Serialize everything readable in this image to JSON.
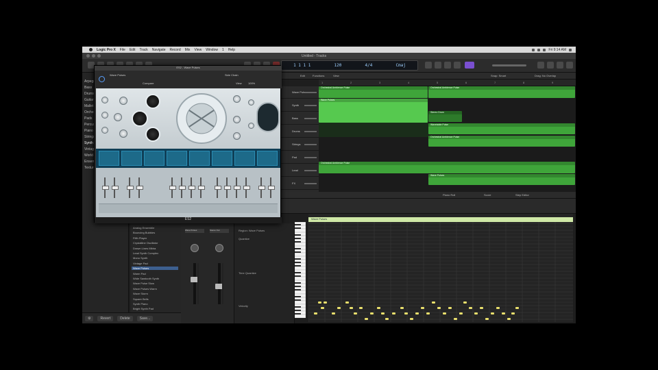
{
  "menubar": {
    "app_name": "Logic Pro X",
    "items": [
      "File",
      "Edit",
      "Track",
      "Navigate",
      "Record",
      "Mix",
      "View",
      "Window",
      "1",
      "Help"
    ],
    "clock": "Fri 9:14 AM"
  },
  "window": {
    "title": "Untitled - Tracks"
  },
  "lcd": {
    "position": "1 1 1 1",
    "tempo": "120",
    "signature": "4/4",
    "key": "Cmaj"
  },
  "library": {
    "categories": [
      "Arpeggiator",
      "Bass",
      "Drums",
      "Guitar",
      "Mallet",
      "Orchestral",
      "Pads",
      "Percussion",
      "Piano",
      "Strings",
      "Synth",
      "Vintage",
      "World",
      "Ensembles",
      "Textures"
    ],
    "selected_category": "Synth"
  },
  "presets": {
    "items": [
      "Analog Ensemble",
      "Bouncing Bubbles",
      "Fifth Player",
      "Crystalline Oscillator",
      "Drawn Lines Mbira",
      "Lead Synth Complex",
      "Mono Synth",
      "Vintage Pad",
      "Wave Pulses",
      "Warm Pad",
      "Wide Sawtooth Synth",
      "Wave Pulse Slow",
      "Wave Pulses Warm",
      "Wave Storm",
      "Square Bells",
      "Synth Piano",
      "Bright Synth Pad"
    ],
    "selected": "Wave Pulses"
  },
  "library_footer": {
    "revert": "Revert",
    "delete": "Delete",
    "save": "Save..."
  },
  "mixer": {
    "strips": [
      {
        "name": "Wave Pulses"
      },
      {
        "name": "Stereo Out"
      }
    ]
  },
  "editor_panel": {
    "region_label": "Region: Wave Pulses",
    "quantize_label": "Quantize",
    "time_quantize_label": "Time Quantize",
    "velocity_label": "Velocity"
  },
  "tracks_toolbar": {
    "edit": "Edit",
    "functions": "Functions",
    "view": "View",
    "snap": "Snap: Smart",
    "drag": "Drag: No Overlap"
  },
  "ruler": {
    "ticks": [
      "1",
      "2",
      "3",
      "4",
      "5",
      "6",
      "7",
      "8",
      "9"
    ]
  },
  "tracks": [
    {
      "name": "Wave Pulses"
    },
    {
      "name": "Synth"
    },
    {
      "name": "Bass"
    },
    {
      "name": "Drums"
    },
    {
      "name": "Strings"
    },
    {
      "name": "Pad"
    },
    {
      "name": "Lead"
    },
    {
      "name": "FX"
    }
  ],
  "regions": [
    {
      "label": "Orchestral Ambience Pulse",
      "color": "#3fa53a"
    },
    {
      "label": "Orchestral Ambience Pulse",
      "color": "#3fa53a"
    },
    {
      "label": "Wave Pulses",
      "color": "#3fa53a"
    },
    {
      "label": "Stereo Drum",
      "color": "#2d7a2a"
    },
    {
      "label": "Wavetable Pulse",
      "color": "#3fa53a"
    },
    {
      "label": "Orchestral Ambience Pulse",
      "color": "#3fa53a"
    },
    {
      "label": "Orchestral Ambience Pulse",
      "color": "#3fa53a"
    },
    {
      "label": "Wave Pulses",
      "color": "#3fa53a"
    }
  ],
  "editor_tabs": {
    "piano_roll": "Piano Roll",
    "score": "Score",
    "step_editor": "Step Editor"
  },
  "piano_roll": {
    "region_name": "Wave Pulses",
    "note_color": "#e9df6c"
  },
  "plugin": {
    "title": "ES2 - Wave Pulses",
    "preset_name": "Wave Pulses",
    "compare": "Compare",
    "view": "View",
    "side_chain": "Side Chain",
    "zoom": "100%",
    "footer_name": "ES2",
    "accent": "#5aa0ff"
  }
}
